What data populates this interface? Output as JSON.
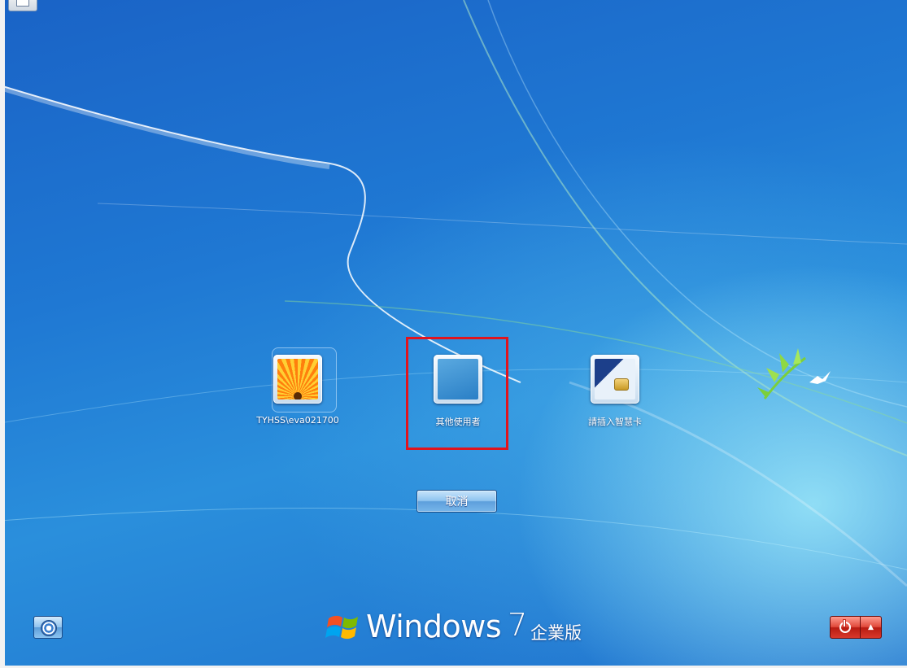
{
  "screen": {
    "name": "Windows 7 logon screen",
    "accent_color": "#1f78d3"
  },
  "tiles": [
    {
      "label": "TYHSS\\eva021700",
      "picture": "orange-flower-picture"
    },
    {
      "label": "其他使用者",
      "picture": "blank-user-picture"
    },
    {
      "label": "請插入智慧卡",
      "picture": "smart-card-picture"
    }
  ],
  "buttons": {
    "cancel_label": "取消",
    "ease_of_access_icon": "ease-of-access-icon",
    "shutdown_icon": "power-icon",
    "shutdown_options_glyph": "▲"
  },
  "branding": {
    "product": "Windows",
    "version": "7",
    "edition": "企業版"
  },
  "highlight": {
    "target": "其他使用者",
    "color": "#e0141e"
  }
}
